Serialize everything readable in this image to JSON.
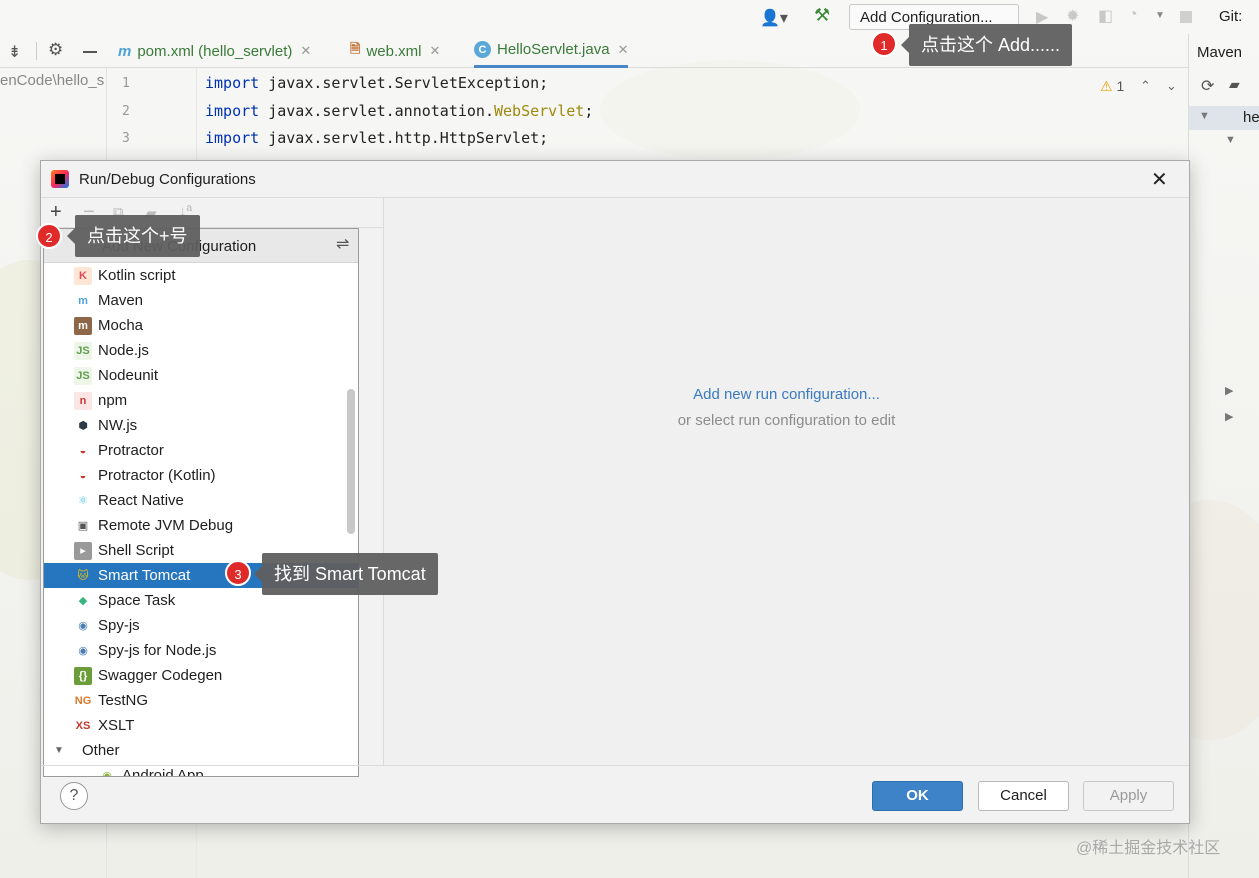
{
  "topbar": {
    "add_configuration": "Add Configuration...",
    "git_label": "Git:"
  },
  "tabs": [
    {
      "label": "pom.xml (hello_servlet)",
      "icon": "m"
    },
    {
      "label": "web.xml",
      "icon": "xml"
    },
    {
      "label": "HelloServlet.java",
      "icon": "C"
    }
  ],
  "maven": {
    "title": "Maven",
    "root_label": "he"
  },
  "editor": {
    "project_path": "enCode\\hello_s",
    "lines": [
      {
        "no": "1",
        "kw": "import",
        "rest_a": " javax.servlet.ServletException;",
        "ann": "",
        "rest_b": ""
      },
      {
        "no": "2",
        "kw": "import",
        "rest_a": " javax.servlet.annotation.",
        "ann": "WebServlet",
        "rest_b": ";"
      },
      {
        "no": "3",
        "kw": "import",
        "rest_a": " javax.servlet.http.HttpServlet;",
        "ann": "",
        "rest_b": ""
      }
    ],
    "warnings_count": "1"
  },
  "dialog": {
    "title": "Run/Debug Configurations",
    "popup_title": "Add New Configuration",
    "items": [
      {
        "label": "Kotlin script",
        "icon": "kotlin-icon",
        "glyph": "K",
        "color": "#e44857",
        "bg": "#fde6d6"
      },
      {
        "label": "Maven",
        "icon": "maven-icon",
        "glyph": "m",
        "color": "#4fa3d8",
        "bg": "transparent"
      },
      {
        "label": "Mocha",
        "icon": "mocha-icon",
        "glyph": "m",
        "color": "#ffffff",
        "bg": "#8d6748"
      },
      {
        "label": "Node.js",
        "icon": "nodejs-icon",
        "glyph": "JS",
        "color": "#5fa04e",
        "bg": "#eef6ea"
      },
      {
        "label": "Nodeunit",
        "icon": "nodeunit-icon",
        "glyph": "JS",
        "color": "#5fa04e",
        "bg": "#eef6ea"
      },
      {
        "label": "npm",
        "icon": "npm-icon",
        "glyph": "n",
        "color": "#cb3837",
        "bg": "#fbe5e5"
      },
      {
        "label": "NW.js",
        "icon": "nwjs-icon",
        "glyph": "⬢",
        "color": "#2f3a48",
        "bg": "transparent"
      },
      {
        "label": "Protractor",
        "icon": "protractor-icon",
        "glyph": "◒",
        "color": "#d32f2f",
        "bg": "transparent"
      },
      {
        "label": "Protractor (Kotlin)",
        "icon": "protractor-kotlin-icon",
        "glyph": "◒",
        "color": "#d32f2f",
        "bg": "transparent"
      },
      {
        "label": "React Native",
        "icon": "react-icon",
        "glyph": "⚛",
        "color": "#38b6e0",
        "bg": "transparent"
      },
      {
        "label": "Remote JVM Debug",
        "icon": "remote-debug-icon",
        "glyph": "▣",
        "color": "#555555",
        "bg": "transparent"
      },
      {
        "label": "Shell Script",
        "icon": "shell-icon",
        "glyph": "▸",
        "color": "#ffffff",
        "bg": "#9a9a9a"
      },
      {
        "label": "Smart Tomcat",
        "icon": "tomcat-icon",
        "glyph": "🐱",
        "color": "#f2c200",
        "bg": "transparent",
        "selected": true
      },
      {
        "label": "Space Task",
        "icon": "space-icon",
        "glyph": "◆",
        "color": "#36b37e",
        "bg": "transparent"
      },
      {
        "label": "Spy-js",
        "icon": "spyjs-icon",
        "glyph": "◉",
        "color": "#4a7fb5",
        "bg": "transparent"
      },
      {
        "label": "Spy-js for Node.js",
        "icon": "spyjs-node-icon",
        "glyph": "◉",
        "color": "#4a7fb5",
        "bg": "transparent"
      },
      {
        "label": "Swagger Codegen",
        "icon": "swagger-icon",
        "glyph": "{}",
        "color": "#ffffff",
        "bg": "#6b9e3a"
      },
      {
        "label": "TestNG",
        "icon": "testng-icon",
        "glyph": "NG",
        "color": "#d8782a",
        "bg": "transparent"
      },
      {
        "label": "XSLT",
        "icon": "xslt-icon",
        "glyph": "XS",
        "color": "#c0392b",
        "bg": "transparent"
      }
    ],
    "group_label": "Other",
    "sub_item": "Android App",
    "add_link": "Add new run configuration...",
    "hint": "or select run configuration to edit",
    "ok": "OK",
    "cancel": "Cancel",
    "apply": "Apply",
    "help": "?"
  },
  "annotations": [
    {
      "num": "1",
      "text": "点击这个 Add......"
    },
    {
      "num": "2",
      "text": "点击这个+号"
    },
    {
      "num": "3",
      "text": "找到 Smart Tomcat"
    }
  ],
  "watermark": "@稀土掘金技术社区"
}
